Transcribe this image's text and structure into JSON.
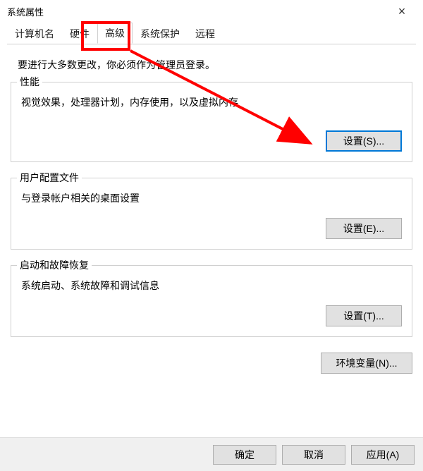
{
  "window": {
    "title": "系统属性"
  },
  "tabs": {
    "items": [
      {
        "label": "计算机名"
      },
      {
        "label": "硬件"
      },
      {
        "label": "高级"
      },
      {
        "label": "系统保护"
      },
      {
        "label": "远程"
      }
    ],
    "active_index": 2
  },
  "intro_text": "要进行大多数更改，你必须作为管理员登录。",
  "groups": {
    "performance": {
      "title": "性能",
      "desc": "视觉效果，处理器计划，内存使用，以及虚拟内存",
      "button": "设置(S)..."
    },
    "profiles": {
      "title": "用户配置文件",
      "desc": "与登录帐户相关的桌面设置",
      "button": "设置(E)..."
    },
    "startup": {
      "title": "启动和故障恢复",
      "desc": "系统启动、系统故障和调试信息",
      "button": "设置(T)..."
    }
  },
  "env_button": "环境变量(N)...",
  "buttons": {
    "ok": "确定",
    "cancel": "取消",
    "apply": "应用(A)"
  },
  "annotation": {
    "highlight": "highlights 高级 tab and points to 设置(S) button"
  }
}
